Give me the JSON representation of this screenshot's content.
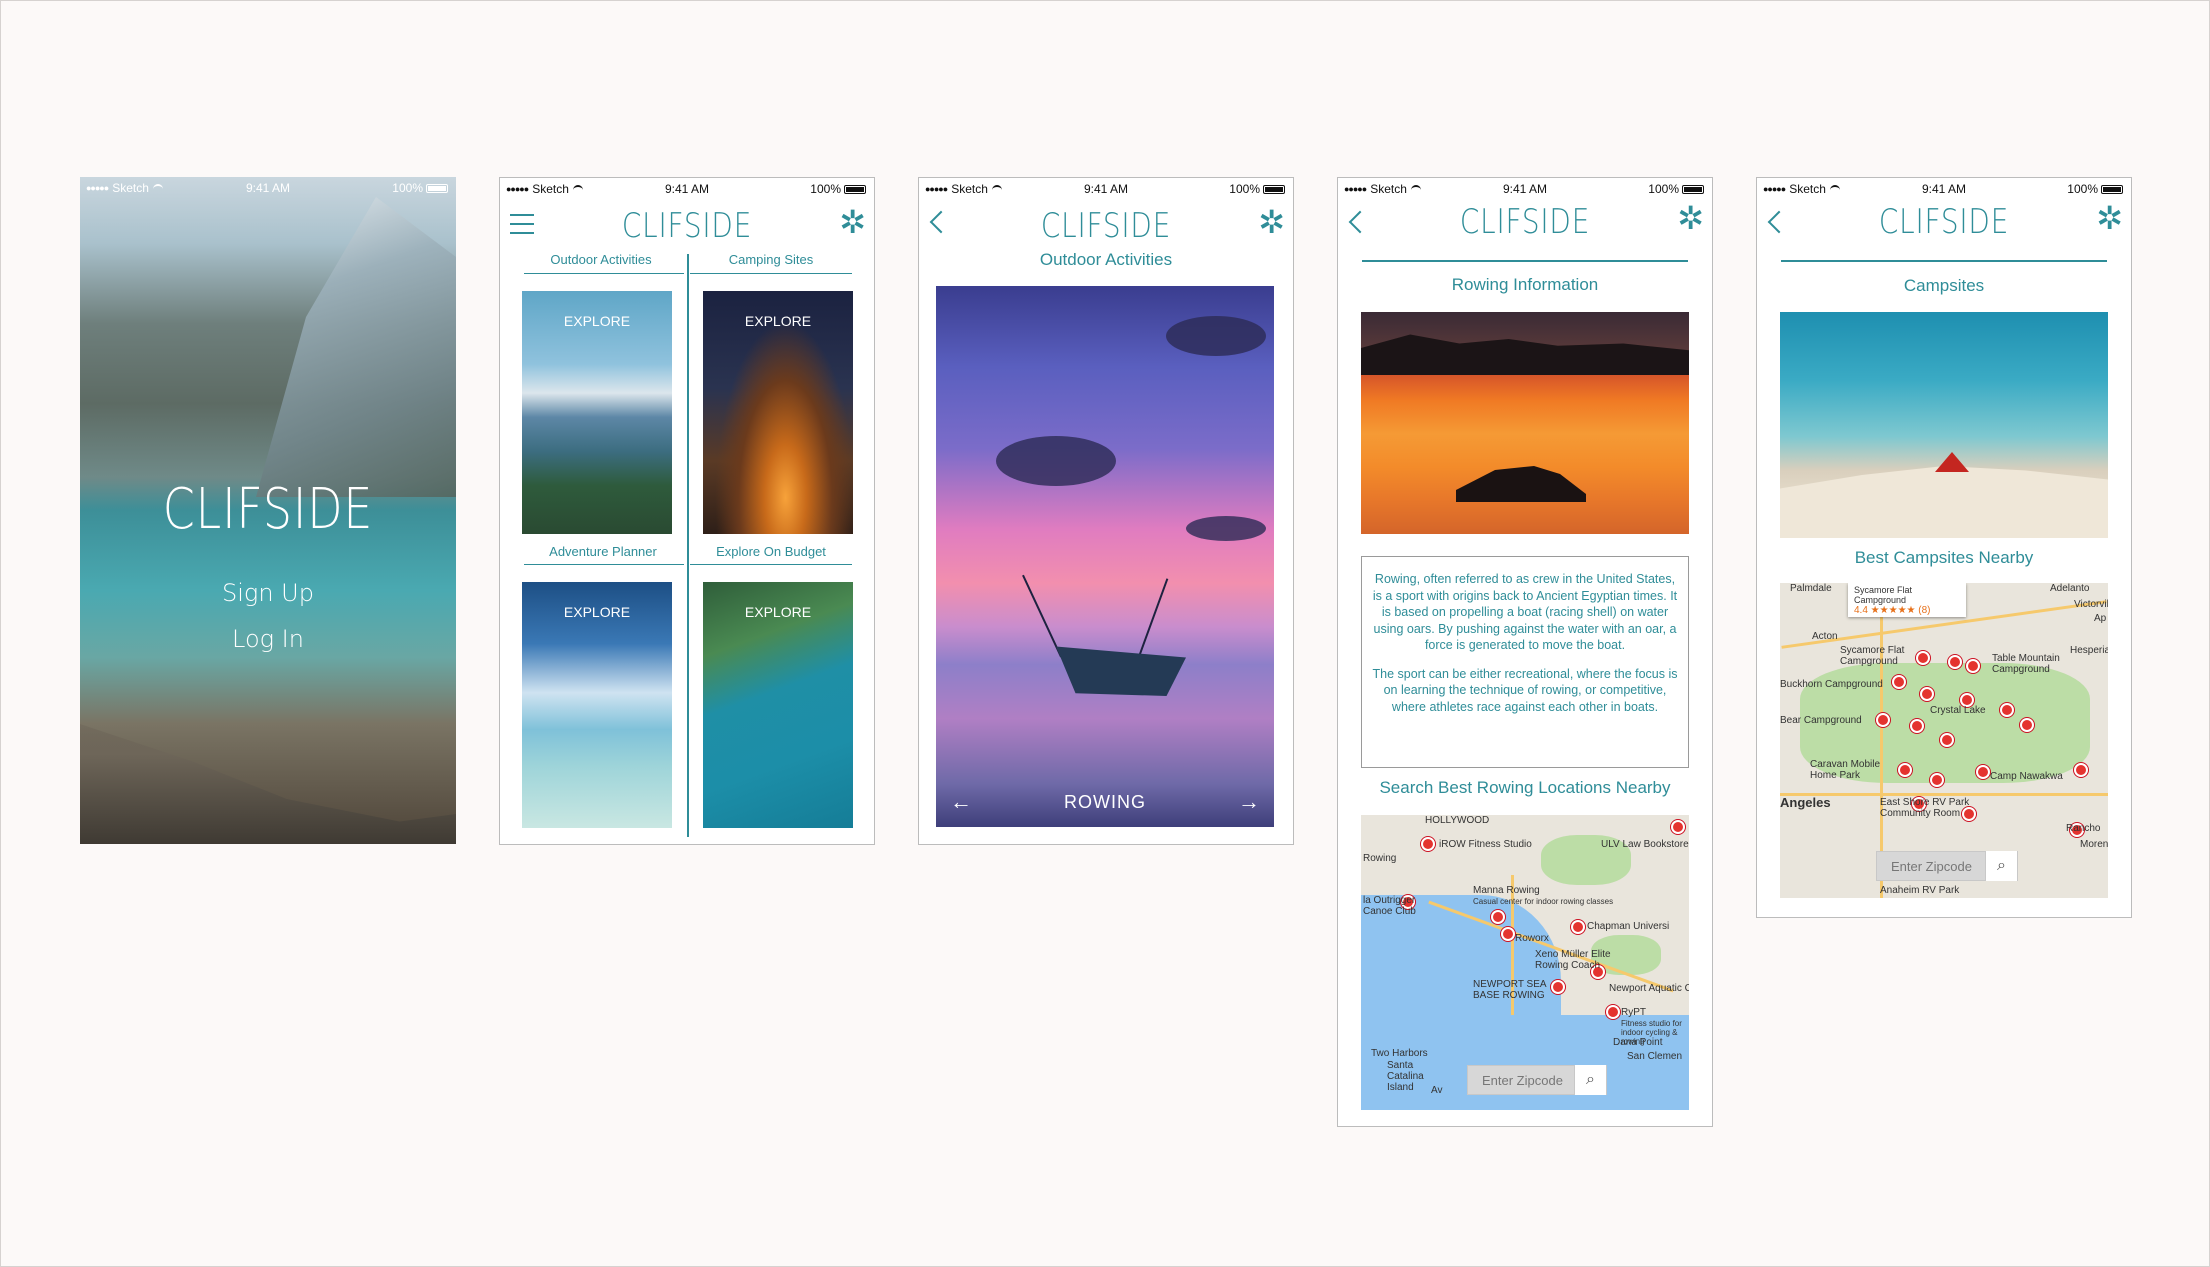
{
  "brand": {
    "name": "CLIFSIDE",
    "accent": "#2f8d98"
  },
  "status": {
    "carrier": "Sketch",
    "time": "9:41 AM",
    "battery": "100%"
  },
  "screen1": {
    "sign_up": "Sign Up",
    "log_in": "Log In"
  },
  "screen2": {
    "categories": [
      {
        "label": "Outdoor Activities",
        "cta": "EXPLORE"
      },
      {
        "label": "Camping Sites",
        "cta": "EXPLORE"
      },
      {
        "label": "Adventure Planner",
        "cta": "EXPLORE"
      },
      {
        "label": "Explore On Budget",
        "cta": "EXPLORE"
      }
    ]
  },
  "screen3": {
    "title": "Outdoor Activities",
    "caption": "ROWING",
    "prev": "←",
    "next": "→"
  },
  "screen4": {
    "title": "Rowing Information",
    "paragraphs": [
      "Rowing, often referred to as crew in the United States, is a sport with origins back to Ancient Egyptian times. It is based on propelling a boat (racing shell) on water using oars. By pushing against the water with an oar, a force is generated to move the boat.",
      "The sport can be either recreational, where the focus is on learning the technique of rowing, or competitive, where athletes race against each other in boats."
    ],
    "search_heading": "Search Best Rowing Locations Nearby",
    "zip_placeholder": "Enter Zipcode",
    "map_labels": [
      "HOLLYWOOD",
      "iROW Fitness Studio",
      "ULV Law Bookstore",
      "Rowing",
      "la Outrigger Canoe Club",
      "Manna Rowing",
      "Casual center for indoor rowing classes",
      "Chapman Universi",
      "Roworx",
      "Xeno Müller Elite Rowing Coach",
      "NEWPORT SEA BASE ROWING",
      "Newport Aquatic Cen",
      "RyPT",
      "Fitness studio for indoor cycling & rowing",
      "Dana Point",
      "Two Harbors",
      "Santa Catalina Island",
      "Av",
      "San Clemen"
    ]
  },
  "screen5": {
    "title": "Campsites",
    "nearby_heading": "Best Campsites Nearby",
    "popup_name": "Sycamore Flat Campground",
    "popup_rating": "4.4 ★★★★★ (8)",
    "zip_placeholder": "Enter Zipcode",
    "map_labels": [
      "Palmdale",
      "Adelanto",
      "Victorvil",
      "Ap",
      "Acton",
      "Sycamore Flat Campground",
      "Table Mountain Campground",
      "Hesperia",
      "Buckhorn Campground",
      "Crystal Lake",
      "Bear Campground",
      "Caravan Mobile Home Park",
      "Camp Nawakwa",
      "Angeles",
      "East Shore RV Park Community Room",
      "Rancho",
      "Moren",
      "Anaheim RV Park"
    ]
  },
  "icons": {
    "menu": "hamburger-icon",
    "back": "chevron-left-icon",
    "settings": "gear-icon",
    "search": "search-icon"
  }
}
